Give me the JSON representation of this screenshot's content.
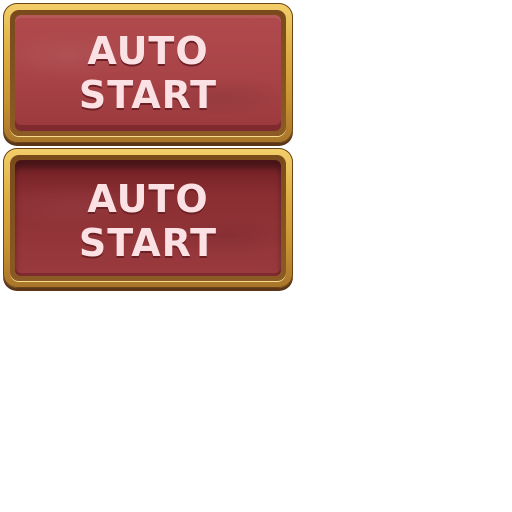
{
  "buttons": {
    "normal": {
      "line1": "AUTO",
      "line2": "START"
    },
    "pressed": {
      "line1": "AUTO",
      "line2": "START"
    }
  },
  "colors": {
    "frame_gold": "#ddae43",
    "face_red": "#a84347",
    "face_pressed": "#8a2e32",
    "text": "#fbe1e3"
  }
}
